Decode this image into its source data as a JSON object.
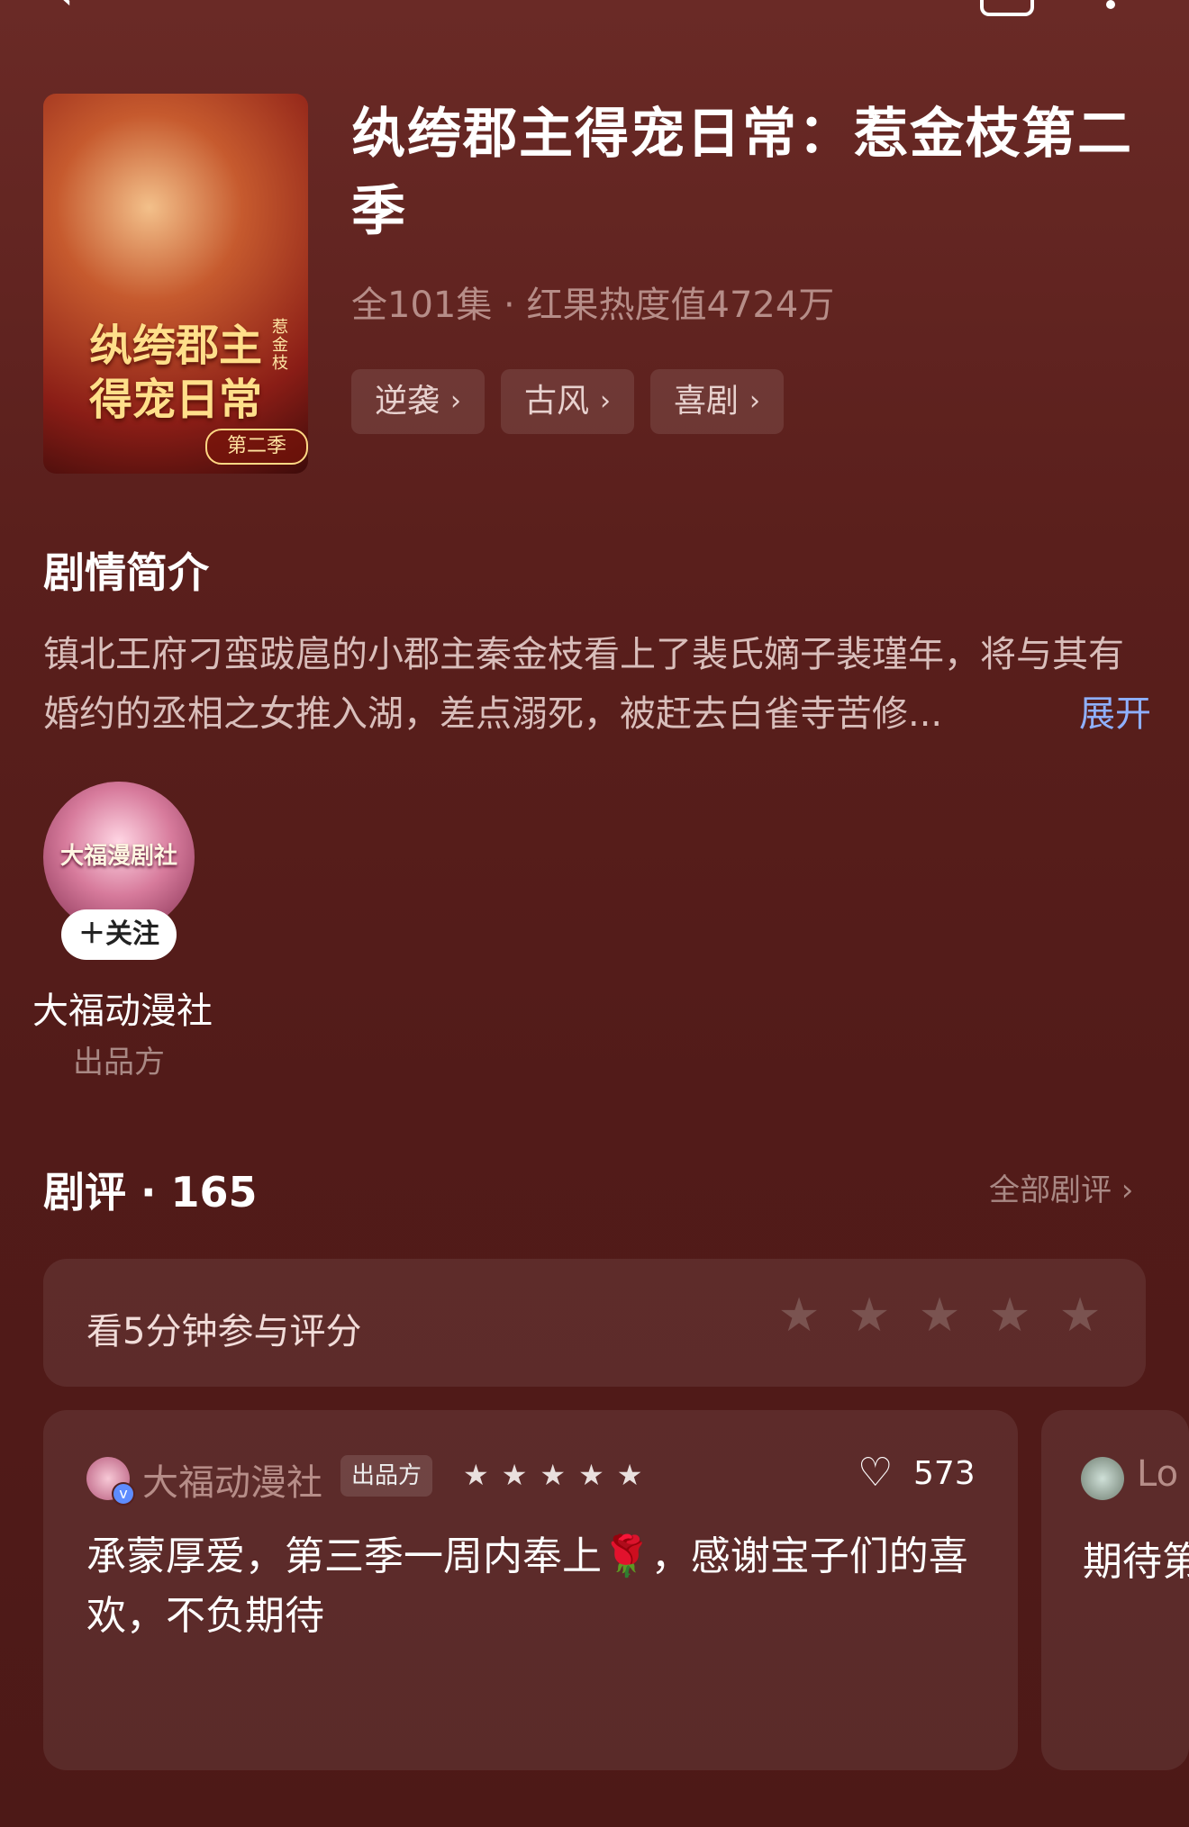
{
  "drama": {
    "title": "纨绔郡主得宠日常：惹金枝第二季",
    "meta": "全101集 · 红果热度值4724万",
    "cover": {
      "title_line1": "纨绔郡主",
      "title_line2": "得宠日常",
      "side_text": "惹金枝",
      "season": "第二季"
    },
    "tags": [
      {
        "label": "逆袭"
      },
      {
        "label": "古风"
      },
      {
        "label": "喜剧"
      }
    ]
  },
  "synopsis": {
    "heading": "剧情简介",
    "text": "镇北王府刁蛮跋扈的小郡主秦金枝看上了裴氏嫡子裴瑾年，将与其有婚约的丞相之女推入湖，差点溺死，被赶去白雀寺苦修...",
    "expand": "展开"
  },
  "publisher": {
    "avatar_text": "大福漫剧社",
    "follow": "＋关注",
    "name": "大福动漫社",
    "role": "出品方"
  },
  "reviews": {
    "heading": "剧评 · 165",
    "all_label": "全部剧评 ›",
    "rating_prompt": "看5分钟参与评分",
    "rating_stars": 5,
    "items": [
      {
        "user": "大福动漫社",
        "badge": "出品方",
        "stars": 5,
        "likes": "573",
        "text": "承蒙厚爱，第三季一周内奉上🌹，感谢宝子们的喜欢，不负期待"
      },
      {
        "user": "Lo",
        "text": "期待第"
      }
    ]
  },
  "icons": {
    "back": "chevron-left-icon",
    "share": "share-box-icon",
    "more": "more-icon",
    "heart": "heart-icon",
    "star": "star-icon",
    "chevron": "chevron-right-icon",
    "verify": "verified-badge-icon"
  }
}
